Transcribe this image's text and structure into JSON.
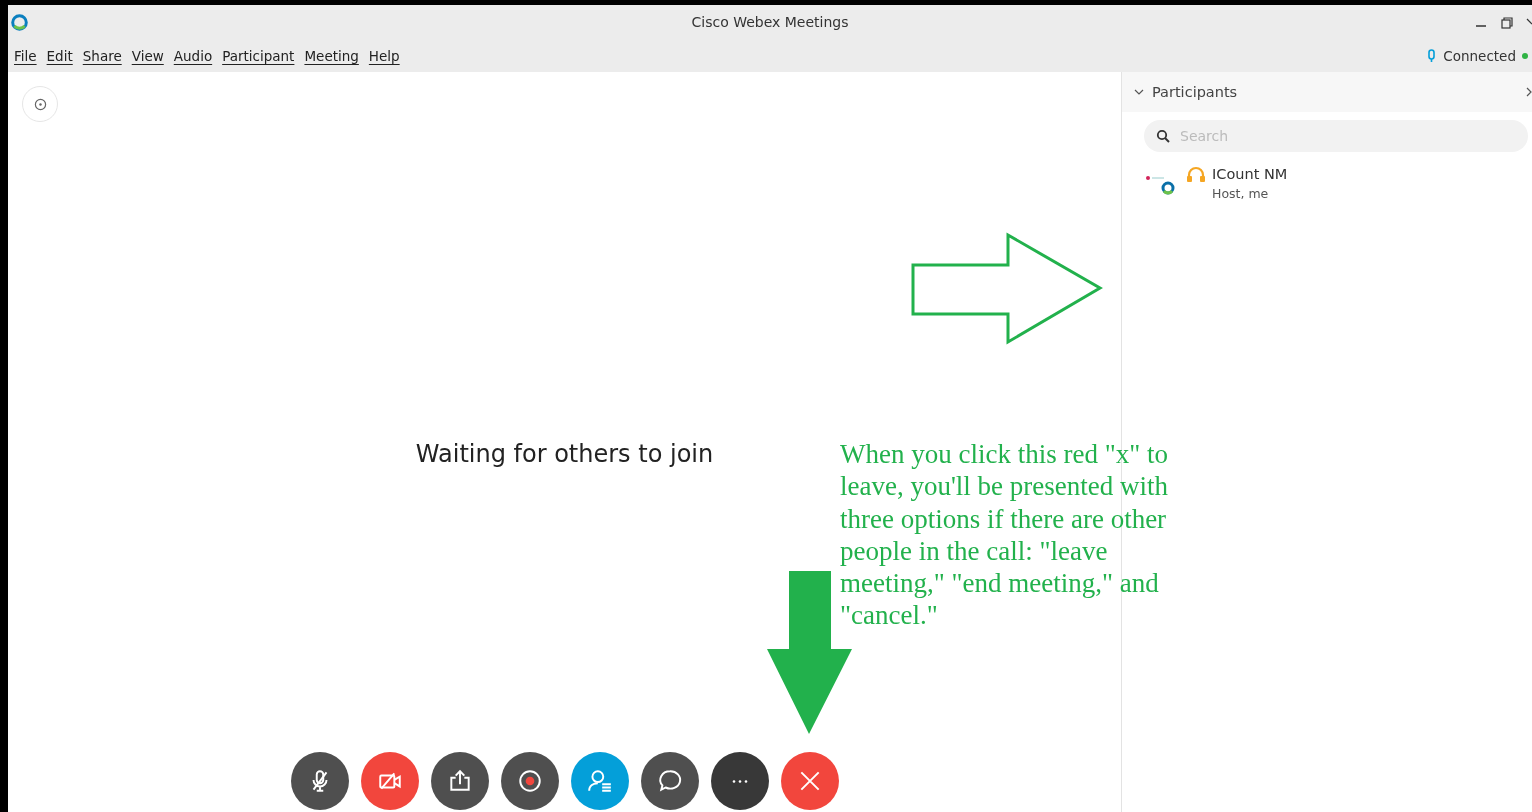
{
  "window": {
    "title": "Cisco Webex Meetings"
  },
  "menu": [
    "File",
    "Edit",
    "Share",
    "View",
    "Audio",
    "Participant",
    "Meeting",
    "Help"
  ],
  "status": {
    "label": "Connected",
    "color": "#2fb344"
  },
  "main": {
    "message": "Waiting for others to join"
  },
  "toolbar": [
    {
      "kind": "mute",
      "color": "#4f4f4f"
    },
    {
      "kind": "video",
      "color": "#f2463d"
    },
    {
      "kind": "share",
      "color": "#4f4f4f"
    },
    {
      "kind": "record",
      "color": "#4f4f4f"
    },
    {
      "kind": "participants",
      "color": "#049fd9"
    },
    {
      "kind": "chat",
      "color": "#4f4f4f"
    },
    {
      "kind": "more",
      "color": "#383838"
    },
    {
      "kind": "leave",
      "color": "#f2463d"
    }
  ],
  "participants_panel": {
    "title": "Participants",
    "expanded": true,
    "search": {
      "placeholder": "Search"
    },
    "items": [
      {
        "name": "ICount NM",
        "role": "Host, me"
      }
    ]
  },
  "annotation": {
    "text": "When you click this red \"x\" to leave, you'll be presented with three options if there are other people in the call: \"leave meeting,\" \"end meeting,\" and \"cancel.\""
  }
}
